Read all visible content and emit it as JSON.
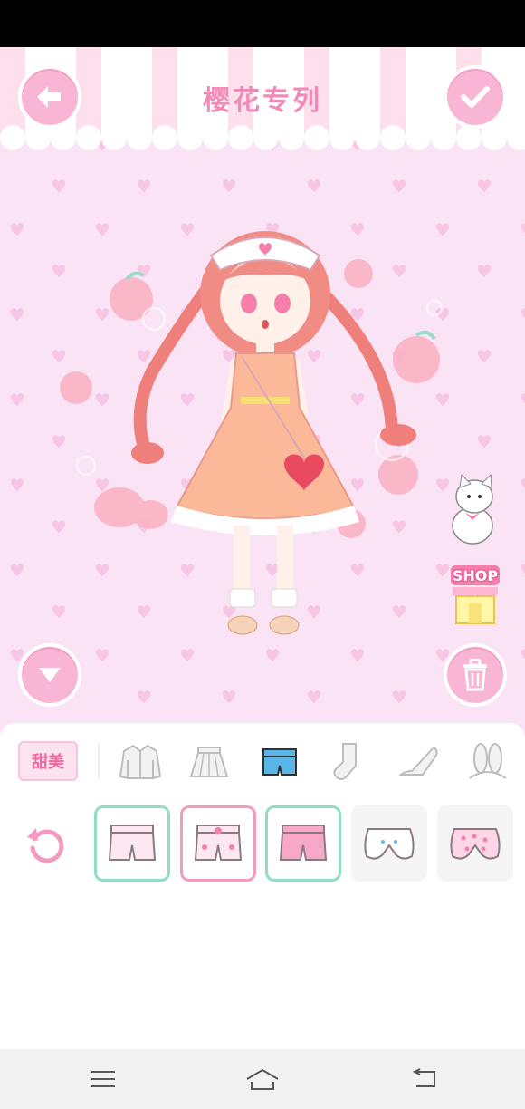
{
  "header": {
    "title": "樱花专列"
  },
  "shop": {
    "label": "SHOP"
  },
  "panel": {
    "style_tag": "甜美",
    "categories": [
      {
        "name": "coat-icon",
        "selected": false
      },
      {
        "name": "skirt-icon",
        "selected": false
      },
      {
        "name": "shorts-icon",
        "selected": true
      },
      {
        "name": "sock-icon",
        "selected": false
      },
      {
        "name": "high-heel-icon",
        "selected": false
      },
      {
        "name": "bunny-ears-icon",
        "selected": false
      }
    ],
    "items": [
      {
        "name": "pink-shorts-plain",
        "state": "owned-green"
      },
      {
        "name": "pink-shorts-bow",
        "state": "selected-pink"
      },
      {
        "name": "pink-shorts-solid",
        "state": "owned-green"
      },
      {
        "name": "white-bloomers-face",
        "state": "locked"
      },
      {
        "name": "pink-bloomers-dots",
        "state": "locked"
      }
    ]
  },
  "colors": {
    "stage_bg": "#fbe3f6",
    "button_pink": "#f9b5d4",
    "title_pink": "#f28ab8",
    "accent_green": "#8fdcc7",
    "selected_blue": "#5ab6e8"
  },
  "icons": {
    "back": "arrow-left-icon",
    "confirm": "checkmark-icon",
    "down": "triangle-down-icon",
    "trash": "trash-icon",
    "reset": "refresh-icon",
    "nav": [
      "menu-icon",
      "home-icon",
      "back-icon"
    ]
  }
}
